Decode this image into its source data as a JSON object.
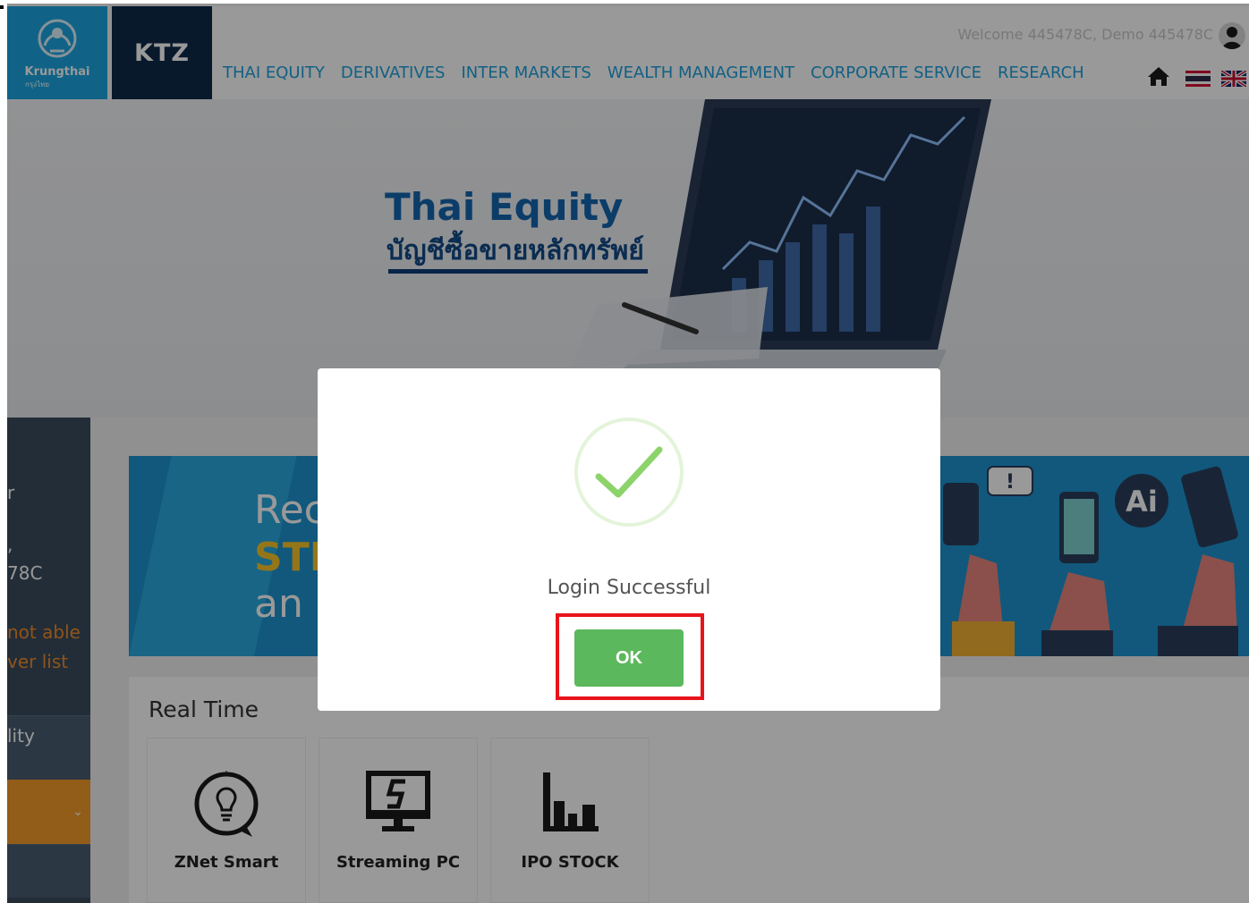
{
  "header": {
    "logo_text": "Krungthai",
    "logo_sub": "กรุงไทย",
    "brand": "KTZ",
    "welcome": "Welcome 445478C, Demo 445478C",
    "nav": [
      "THAI EQUITY",
      "DERIVATIVES",
      "INTER MARKETS",
      "WEALTH MANAGEMENT",
      "CORPORATE SERVICE",
      "RESEARCH"
    ],
    "icons": [
      "home-icon",
      "thai-flag-icon",
      "uk-flag-icon",
      "user-avatar-icon"
    ]
  },
  "hero": {
    "title": "Thai Equity",
    "subtitle": "บัญชีซื้อขายหลักทรัพย์"
  },
  "sidebar": {
    "fragment_1": "r",
    "fragment_2": ",",
    "fragment_3": "78C",
    "fragment_4": "not able",
    "fragment_5": "ver list",
    "item_label": "lity"
  },
  "banner": {
    "line1": "Rec",
    "line2": "STR",
    "line3": "an",
    "badge": "Ai"
  },
  "realtime": {
    "title": "Real Time",
    "tiles": [
      {
        "label": "ZNet Smart",
        "icon": "lightbulb-icon"
      },
      {
        "label": "Streaming PC",
        "icon": "monitor-icon"
      },
      {
        "label": "IPO STOCK",
        "icon": "bar-chart-icon"
      }
    ]
  },
  "modal": {
    "message": "Login Successful",
    "ok_label": "OK",
    "icon": "checkmark-icon"
  },
  "colors": {
    "brand_blue": "#1ba5e1",
    "nav_blue": "#1ea0dc",
    "ok_green": "#5cb85c",
    "highlight_red": "#e8141c"
  }
}
